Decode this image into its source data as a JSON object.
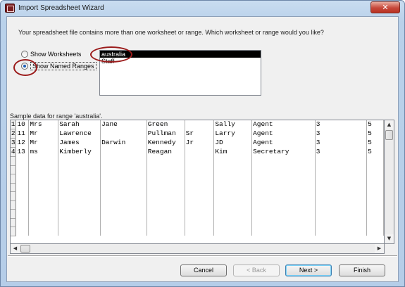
{
  "window": {
    "title": "Import Spreadsheet Wizard",
    "close_glyph": "✕"
  },
  "prompt": "Your spreadsheet file contains more than one worksheet or range. Which worksheet or range would you like?",
  "options": {
    "show_worksheets": "Show Worksheets",
    "show_named_ranges": "Show Named Ranges",
    "selected": "show_named_ranges"
  },
  "ranges": {
    "items": [
      "australia",
      "Staff"
    ],
    "selected_index": 0
  },
  "sample_label": "Sample data for range 'australia'.",
  "grid": {
    "rows": [
      [
        "1",
        "10",
        "Mrs",
        "Sarah",
        "Jane",
        "Green",
        "",
        "Sally",
        "Agent",
        "3",
        "5"
      ],
      [
        "2",
        "11",
        "Mr",
        "Lawrence",
        "",
        "Pullman",
        "Sr",
        "Larry",
        "Agent",
        "3",
        "5"
      ],
      [
        "3",
        "12",
        "Mr",
        "James",
        "Darwin",
        "Kennedy",
        "Jr",
        "JD",
        "Agent",
        "3",
        "5"
      ],
      [
        "4",
        "13",
        "ms",
        "Kimberly",
        "",
        "Reagan",
        "",
        "Kim",
        "Secretary",
        "3",
        "5"
      ]
    ],
    "empty_rows": 9
  },
  "buttons": {
    "cancel": "Cancel",
    "back": "< Back",
    "next": "Next >",
    "finish": "Finish"
  },
  "colors": {
    "callout": "#9b1b1b",
    "selection": "#000000",
    "title_bar": "#c9dcf0"
  },
  "icons": {
    "app": "access-app-icon",
    "close": "close-icon",
    "scroll_up": "chevron-up-icon",
    "scroll_down": "chevron-down-icon",
    "scroll_left": "chevron-left-icon",
    "scroll_right": "chevron-right-icon"
  }
}
